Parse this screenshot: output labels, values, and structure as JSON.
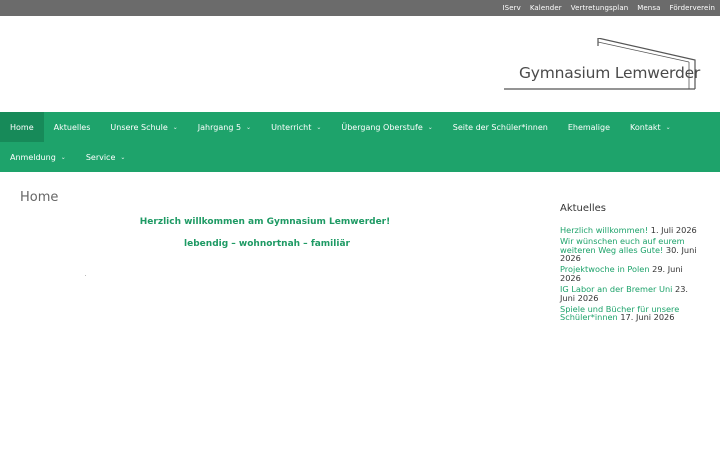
{
  "topbar": {
    "links": [
      "IServ",
      "Kalender",
      "Vertretungsplan",
      "Mensa",
      "Förderverein"
    ]
  },
  "logo": {
    "text": "Gymnasium Lemwerder"
  },
  "nav": {
    "row1": [
      {
        "label": "Home",
        "dropdown": false,
        "active": true
      },
      {
        "label": "Aktuelles",
        "dropdown": false
      },
      {
        "label": "Unsere Schule",
        "dropdown": true
      },
      {
        "label": "Jahrgang 5",
        "dropdown": true
      },
      {
        "label": "Unterricht",
        "dropdown": true
      },
      {
        "label": "Übergang Oberstufe",
        "dropdown": true
      },
      {
        "label": "Seite der Schüler*innen",
        "dropdown": false
      },
      {
        "label": "Ehemalige",
        "dropdown": false
      },
      {
        "label": "Kontakt",
        "dropdown": true
      }
    ],
    "row2": [
      {
        "label": "Anmeldung",
        "dropdown": true
      },
      {
        "label": "Service",
        "dropdown": true
      }
    ],
    "chevron": "⌄"
  },
  "main": {
    "title": "Home",
    "welcome": "Herzlich willkommen am Gymnasium Lemwerder!",
    "tagline": "lebendig – wohnortnah – familiär"
  },
  "sidebar": {
    "heading": "Aktuelles",
    "items": [
      {
        "title": "Herzlich willkommen!",
        "date": "1. Juli 2026"
      },
      {
        "title": "Wir wünschen euch auf eurem weiteren Weg alles Gute!",
        "date": "30. Juni 2026"
      },
      {
        "title": "Projektwoche in Polen",
        "date": "29. Juni 2026"
      },
      {
        "title": "IG Labor an der Bremer Uni",
        "date": "23. Juni 2026"
      },
      {
        "title": "Spiele und Bücher für unsere Schüler*innen",
        "date": "17. Juni 2026"
      }
    ]
  },
  "colors": {
    "accent": "#1ea36b",
    "nav_active": "#178a59",
    "topbar": "#6b6b6b"
  }
}
